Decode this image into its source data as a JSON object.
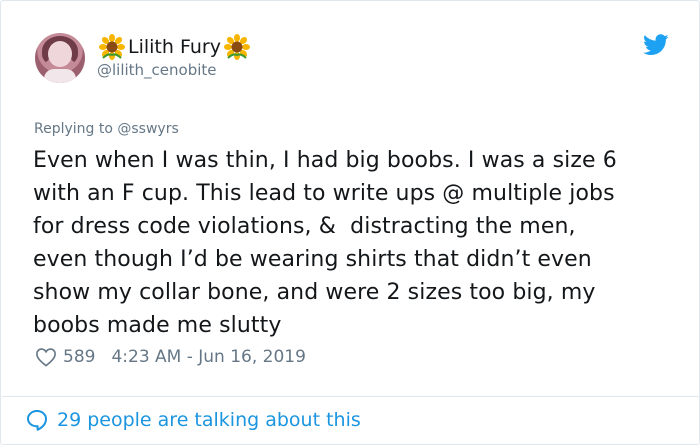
{
  "author": {
    "name": "Lilith Fury",
    "handle": "@lilith_cenobite",
    "name_emoji": "sunflower-icon"
  },
  "reply": {
    "text": "Replying to @sswyrs"
  },
  "tweet": {
    "text": "Even when I was thin, I had big boobs. I was a size 6\nwith an F cup. This lead to write ups @ multiple jobs\nfor dress code violations, &  distracting the men,\neven though I’d be wearing shirts that didn’t even\nshow my collar bone, and were 2 sizes too big, my\nboobs made me slutty"
  },
  "meta": {
    "likes": "589",
    "timestamp": "4:23 AM - Jun 16, 2019"
  },
  "conversation": {
    "text": "29 people are talking about this"
  },
  "colors": {
    "text": "#14171a",
    "secondary": "#657786",
    "accent": "#1b95e0",
    "twitter_blue": "#1da1f2",
    "border": "#e1e8ed"
  }
}
